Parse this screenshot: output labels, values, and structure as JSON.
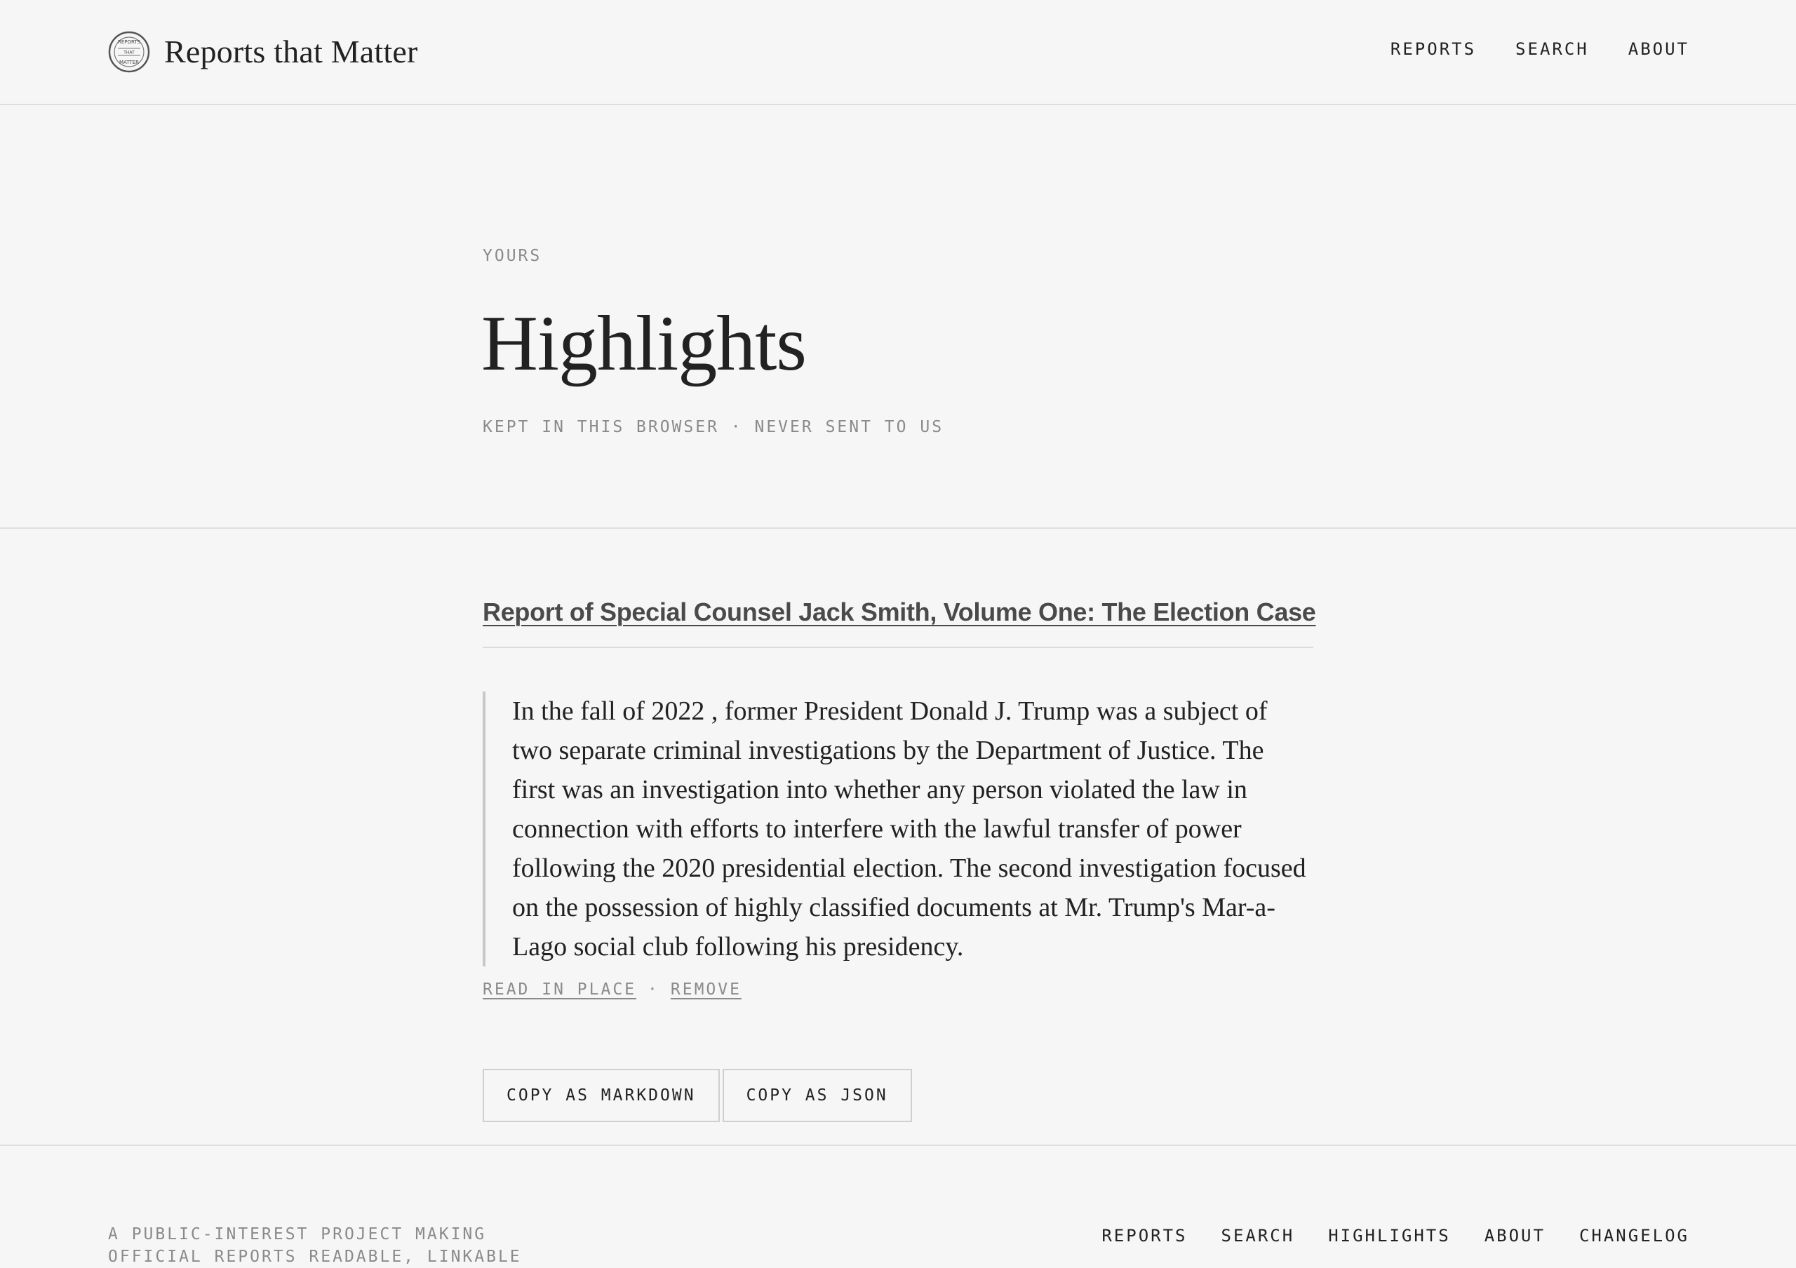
{
  "header": {
    "brand_name": "Reports that Matter",
    "logo_text_top": "REPORTS",
    "logo_text_middle": "THAT",
    "logo_text_bottom": "MATTER",
    "nav": [
      {
        "label": "REPORTS"
      },
      {
        "label": "SEARCH"
      },
      {
        "label": "ABOUT"
      }
    ]
  },
  "hero": {
    "eyebrow": "YOURS",
    "title": "Highlights",
    "subtitle": "KEPT IN THIS BROWSER · NEVER SENT TO US"
  },
  "highlight": {
    "report_title": "Report of Special Counsel Jack Smith, Volume One: The Election Case",
    "quote": "In the fall of 2022 , former President Donald J. Trump was a subject of two separate criminal investigations by the Department of Justice. The first was an investigation into whether any person violated the law in connection with efforts to interfere with the lawful transfer of power following the 2020 presidential election. The second investigation focused on the possession of highly classified documents at Mr. Trump's Mar-a-Lago social club following his presidency.",
    "read_in_place": "READ IN PLACE",
    "separator": "·",
    "remove": "REMOVE"
  },
  "buttons": {
    "copy_markdown": "COPY AS MARKDOWN",
    "copy_json": "COPY AS JSON"
  },
  "footer": {
    "tagline": "A PUBLIC-INTEREST PROJECT MAKING OFFICIAL REPORTS READABLE, LINKABLE",
    "nav": [
      {
        "label": "REPORTS"
      },
      {
        "label": "SEARCH"
      },
      {
        "label": "HIGHLIGHTS"
      },
      {
        "label": "ABOUT"
      },
      {
        "label": "CHANGELOG"
      }
    ]
  },
  "colors": {
    "background": "#f6f6f6",
    "text": "#222222",
    "muted": "#8a8a8a",
    "rule": "#dedede"
  }
}
